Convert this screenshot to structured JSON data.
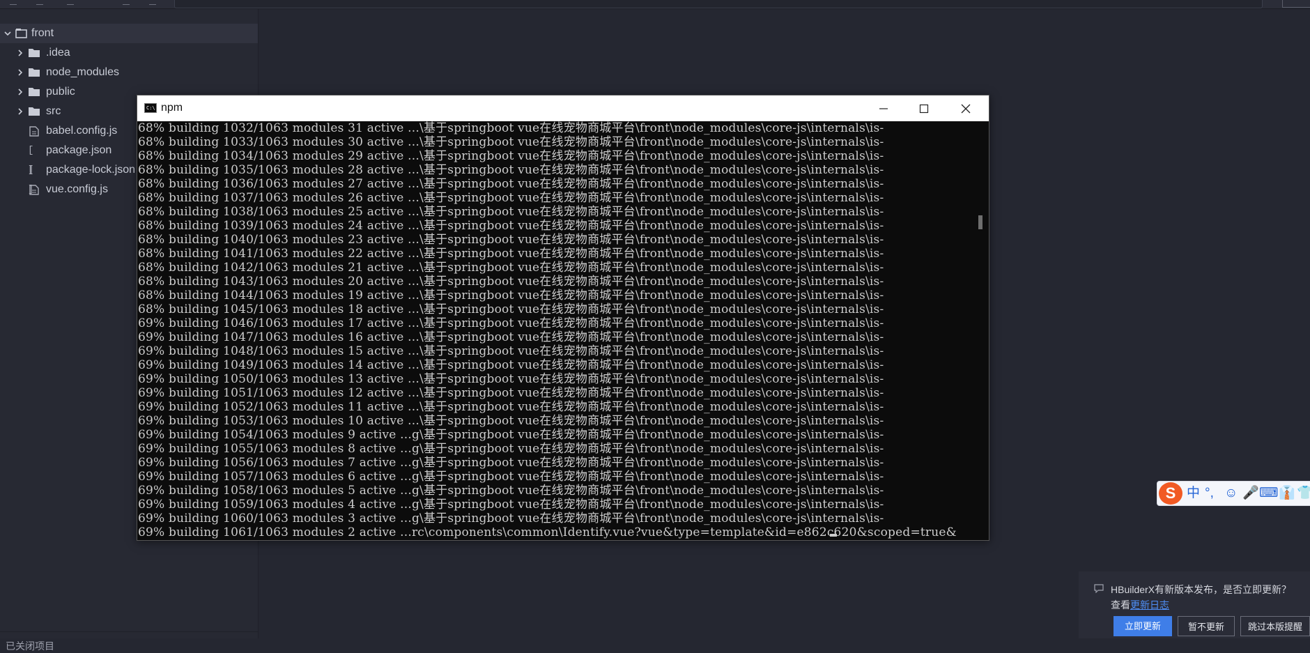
{
  "sidebar": {
    "root": "front",
    "items": [
      {
        "label": ".idea",
        "type": "folder"
      },
      {
        "label": "node_modules",
        "type": "folder"
      },
      {
        "label": "public",
        "type": "folder"
      },
      {
        "label": "src",
        "type": "folder"
      },
      {
        "label": "babel.config.js",
        "type": "js-file"
      },
      {
        "label": "package.json",
        "type": "json-file"
      },
      {
        "label": "package-lock.json",
        "type": "json-file"
      },
      {
        "label": "vue.config.js",
        "type": "js-file"
      }
    ],
    "bottom_label": "已关闭项目"
  },
  "console": {
    "title": "npm",
    "lines": [
      "68% building 1032/1063 modules 31 active ...\\基于springboot vue在线宠物商城平台\\front\\node_modules\\core-js\\internals\\is-",
      "68% building 1033/1063 modules 30 active ...\\基于springboot vue在线宠物商城平台\\front\\node_modules\\core-js\\internals\\is-",
      "68% building 1034/1063 modules 29 active ...\\基于springboot vue在线宠物商城平台\\front\\node_modules\\core-js\\internals\\is-",
      "68% building 1035/1063 modules 28 active ...\\基于springboot vue在线宠物商城平台\\front\\node_modules\\core-js\\internals\\is-",
      "68% building 1036/1063 modules 27 active ...\\基于springboot vue在线宠物商城平台\\front\\node_modules\\core-js\\internals\\is-",
      "68% building 1037/1063 modules 26 active ...\\基于springboot vue在线宠物商城平台\\front\\node_modules\\core-js\\internals\\is-",
      "68% building 1038/1063 modules 25 active ...\\基于springboot vue在线宠物商城平台\\front\\node_modules\\core-js\\internals\\is-",
      "68% building 1039/1063 modules 24 active ...\\基于springboot vue在线宠物商城平台\\front\\node_modules\\core-js\\internals\\is-",
      "68% building 1040/1063 modules 23 active ...\\基于springboot vue在线宠物商城平台\\front\\node_modules\\core-js\\internals\\is-",
      "68% building 1041/1063 modules 22 active ...\\基于springboot vue在线宠物商城平台\\front\\node_modules\\core-js\\internals\\is-",
      "68% building 1042/1063 modules 21 active ...\\基于springboot vue在线宠物商城平台\\front\\node_modules\\core-js\\internals\\is-",
      "68% building 1043/1063 modules 20 active ...\\基于springboot vue在线宠物商城平台\\front\\node_modules\\core-js\\internals\\is-",
      "68% building 1044/1063 modules 19 active ...\\基于springboot vue在线宠物商城平台\\front\\node_modules\\core-js\\internals\\is-",
      "68% building 1045/1063 modules 18 active ...\\基于springboot vue在线宠物商城平台\\front\\node_modules\\core-js\\internals\\is-",
      "69% building 1046/1063 modules 17 active ...\\基于springboot vue在线宠物商城平台\\front\\node_modules\\core-js\\internals\\is-",
      "69% building 1047/1063 modules 16 active ...\\基于springboot vue在线宠物商城平台\\front\\node_modules\\core-js\\internals\\is-",
      "69% building 1048/1063 modules 15 active ...\\基于springboot vue在线宠物商城平台\\front\\node_modules\\core-js\\internals\\is-",
      "69% building 1049/1063 modules 14 active ...\\基于springboot vue在线宠物商城平台\\front\\node_modules\\core-js\\internals\\is-",
      "69% building 1050/1063 modules 13 active ...\\基于springboot vue在线宠物商城平台\\front\\node_modules\\core-js\\internals\\is-",
      "69% building 1051/1063 modules 12 active ...\\基于springboot vue在线宠物商城平台\\front\\node_modules\\core-js\\internals\\is-",
      "69% building 1052/1063 modules 11 active ...\\基于springboot vue在线宠物商城平台\\front\\node_modules\\core-js\\internals\\is-",
      "69% building 1053/1063 modules 10 active ...\\基于springboot vue在线宠物商城平台\\front\\node_modules\\core-js\\internals\\is-",
      "69% building 1054/1063 modules 9 active ...g\\基于springboot vue在线宠物商城平台\\front\\node_modules\\core-js\\internals\\is-",
      "69% building 1055/1063 modules 8 active ...g\\基于springboot vue在线宠物商城平台\\front\\node_modules\\core-js\\internals\\is-",
      "69% building 1056/1063 modules 7 active ...g\\基于springboot vue在线宠物商城平台\\front\\node_modules\\core-js\\internals\\is-",
      "69% building 1057/1063 modules 6 active ...g\\基于springboot vue在线宠物商城平台\\front\\node_modules\\core-js\\internals\\is-",
      "69% building 1058/1063 modules 5 active ...g\\基于springboot vue在线宠物商城平台\\front\\node_modules\\core-js\\internals\\is-",
      "69% building 1059/1063 modules 4 active ...g\\基于springboot vue在线宠物商城平台\\front\\node_modules\\core-js\\internals\\is-",
      "69% building 1060/1063 modules 3 active ...g\\基于springboot vue在线宠物商城平台\\front\\node_modules\\core-js\\internals\\is-",
      "69% building 1061/1063 modules 2 active ...rc\\components\\common\\Identify.vue?vue&type=template&id=e862c620&scoped=true&"
    ]
  },
  "ime": {
    "logo": "S",
    "items": [
      "中",
      "°,",
      "☺",
      "🎤",
      "⌨",
      "👔",
      "👕"
    ]
  },
  "update": {
    "line1": "HBuilderX有新版本发布，是否立即更新？",
    "line2_prefix": "查看",
    "link": "更新日志",
    "btn_now": "立即更新",
    "btn_later": "暂不更新",
    "btn_skip": "跳过本版提醒"
  },
  "colors": {
    "ide_bg": "#252731",
    "sidebar_bg": "#272933",
    "console_bg": "#0c0c0c",
    "console_text": "#cccccc",
    "accent": "#3f7ee8",
    "ime_brand": "#f15a24"
  },
  "icons": {
    "folder": "folder-icon",
    "js_file": "file-icon",
    "json_file": "json-brackets-icon",
    "close": "close-icon",
    "maximize": "maximize-icon",
    "minimize": "minimize-icon"
  }
}
